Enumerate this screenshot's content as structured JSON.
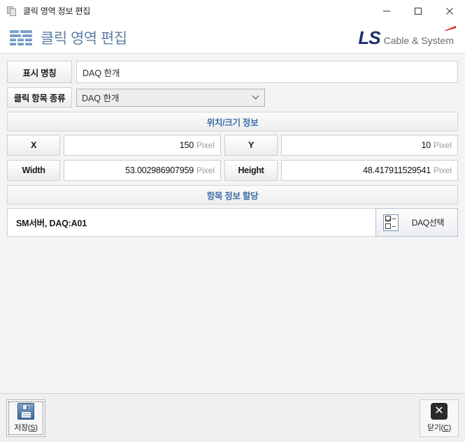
{
  "window": {
    "title": "클릭 영역 정보 편집",
    "titlebar_icon": "window-copy-icon",
    "minimize_label": "—",
    "maximize_label": "□",
    "close_label": "✕"
  },
  "header": {
    "icon": "grid-bars-icon",
    "title": "클릭 영역 편집",
    "logo": {
      "mark": "LS",
      "text": "Cable & System",
      "mark_color": "#1b2f6b",
      "swoosh_color": "#e2231a",
      "text_color": "#6b6b6b"
    },
    "title_color": "#5d7fa3"
  },
  "form": {
    "name_label": "표시 명칭",
    "name_value": "DAQ 한개",
    "type_label": "클릭 항목 종류",
    "type_value": "DAQ 한개",
    "type_options": [
      "DAQ 한개"
    ],
    "dropdown_icon": "chevron-down-icon"
  },
  "position_section": {
    "header": "위치/크기 정보",
    "unit": "Pixel",
    "fields": [
      {
        "label": "X",
        "value": "150"
      },
      {
        "label": "Y",
        "value": "10"
      },
      {
        "label": "Width",
        "value": "53.002986907959"
      },
      {
        "label": "Height",
        "value": "48.417911529541"
      }
    ]
  },
  "assign_section": {
    "header": "항목 정보 할당",
    "value": "SM서버, DAQ:A01",
    "button_label": "DAQ선택",
    "button_icon": "checklist-icon"
  },
  "footer": {
    "save": {
      "label_pre": "저장(",
      "accel": "S",
      "label_post": ")",
      "icon": "floppy-disk-icon"
    },
    "close": {
      "label_pre": "닫기(",
      "accel": "C",
      "label_post": ")",
      "icon": "close-x-icon"
    }
  },
  "colors": {
    "accent_blue": "#3f6fa8",
    "header_blue": "#5d7fa3",
    "background": "#f4f4f4"
  }
}
